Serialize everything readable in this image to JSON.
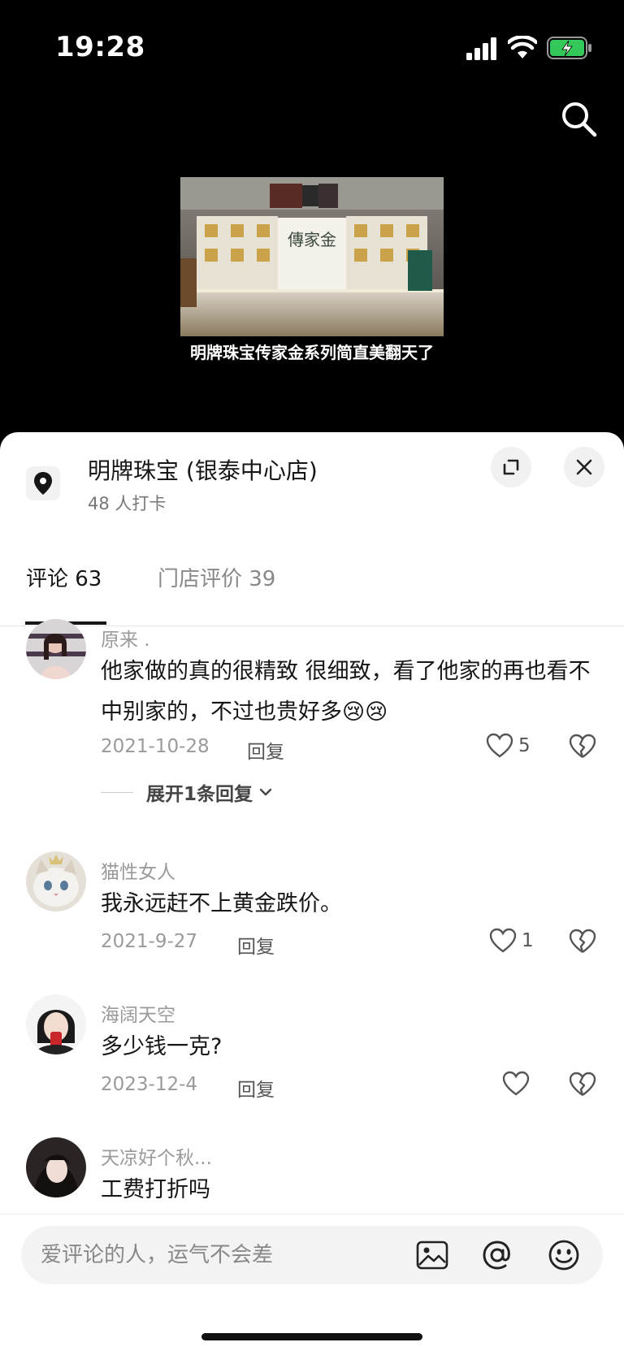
{
  "status_bar": {
    "time": "19:28"
  },
  "video": {
    "caption": "明牌珠宝传家金系列简直美翻天了",
    "sign_text": "傳家金"
  },
  "store": {
    "name": "明牌珠宝 (银泰中心店)",
    "checkins": "48 人打卡"
  },
  "tabs": [
    {
      "label": "评论 63",
      "active": true
    },
    {
      "label": "门店评价 39",
      "active": false
    }
  ],
  "comments": [
    {
      "user": "原来 .",
      "text": "他家做的真的很精致 很细致，看了他家的再也看不中别家的，不过也贵好多😢😢",
      "date": "2021-10-28",
      "reply_label": "回复",
      "likes": "5",
      "expand_label": "展开1条回复"
    },
    {
      "user": "猫性女人",
      "text": "我永远赶不上黄金跌价。",
      "date": "2021-9-27",
      "reply_label": "回复",
      "likes": "1"
    },
    {
      "user": "海阔天空",
      "text": "多少钱一克?",
      "date": "2023-12-4",
      "reply_label": "回复",
      "likes": ""
    },
    {
      "user": "天凉好个秋...",
      "text": "工费打折吗"
    }
  ],
  "input": {
    "placeholder": "爱评论的人，运气不会差"
  },
  "icons": {
    "search": "search-icon",
    "location": "location-pin-icon",
    "expand": "expand-icon",
    "close": "close-icon",
    "like": "heart-icon",
    "dislike": "broken-heart-icon",
    "image": "image-icon",
    "mention": "at-icon",
    "emoji": "emoji-icon"
  },
  "colors": {
    "accent": "#161616",
    "battery": "#34c759",
    "muted": "#9a9a9a"
  }
}
